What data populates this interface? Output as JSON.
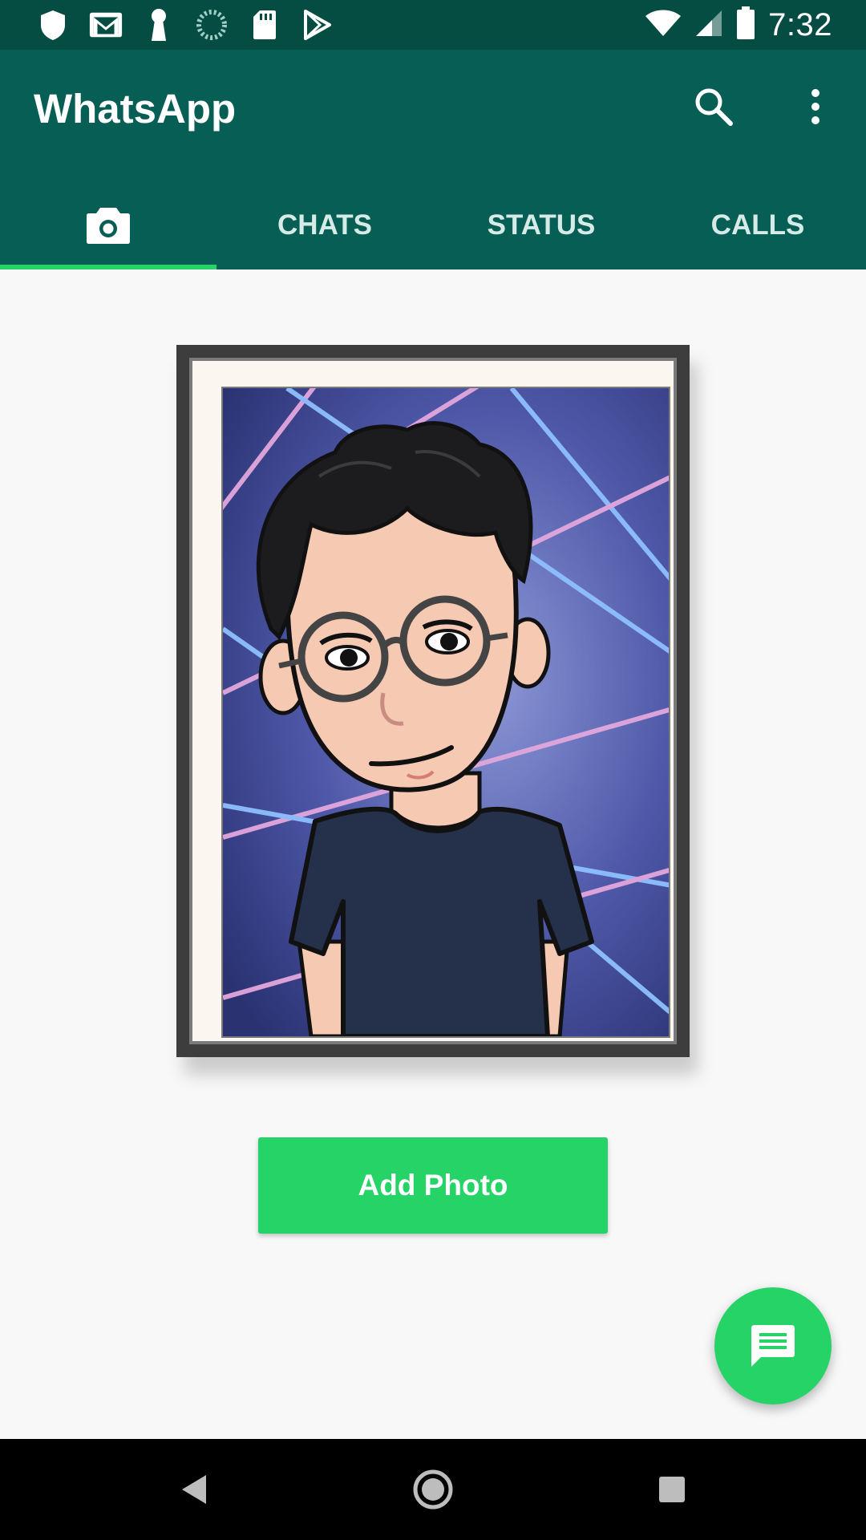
{
  "status_bar": {
    "time": "7:32",
    "left_icons": [
      "shield-icon",
      "gmail-icon",
      "keyhole-icon",
      "loading-icon",
      "sd-card-icon",
      "play-store-icon"
    ],
    "right_icons": [
      "wifi-icon",
      "signal-icon",
      "battery-icon"
    ]
  },
  "app_bar": {
    "title": "WhatsApp",
    "actions": [
      "search-icon",
      "more-vert-icon"
    ]
  },
  "tabs": [
    {
      "label": "",
      "icon": "camera-icon",
      "active": true
    },
    {
      "label": "CHATS",
      "active": false
    },
    {
      "label": "STATUS",
      "active": false
    },
    {
      "label": "CALLS",
      "active": false
    }
  ],
  "content": {
    "image": "bitmoji-avatar-in-picture-frame",
    "add_photo_label": "Add Photo"
  },
  "fab": {
    "icon": "new-chat-icon"
  },
  "nav_bar": {
    "buttons": [
      "back-icon",
      "home-icon",
      "recents-icon"
    ]
  },
  "colors": {
    "status_bar": "#054d43",
    "app_bar": "#075e54",
    "accent": "#25d366",
    "background": "#f8f8f8"
  }
}
